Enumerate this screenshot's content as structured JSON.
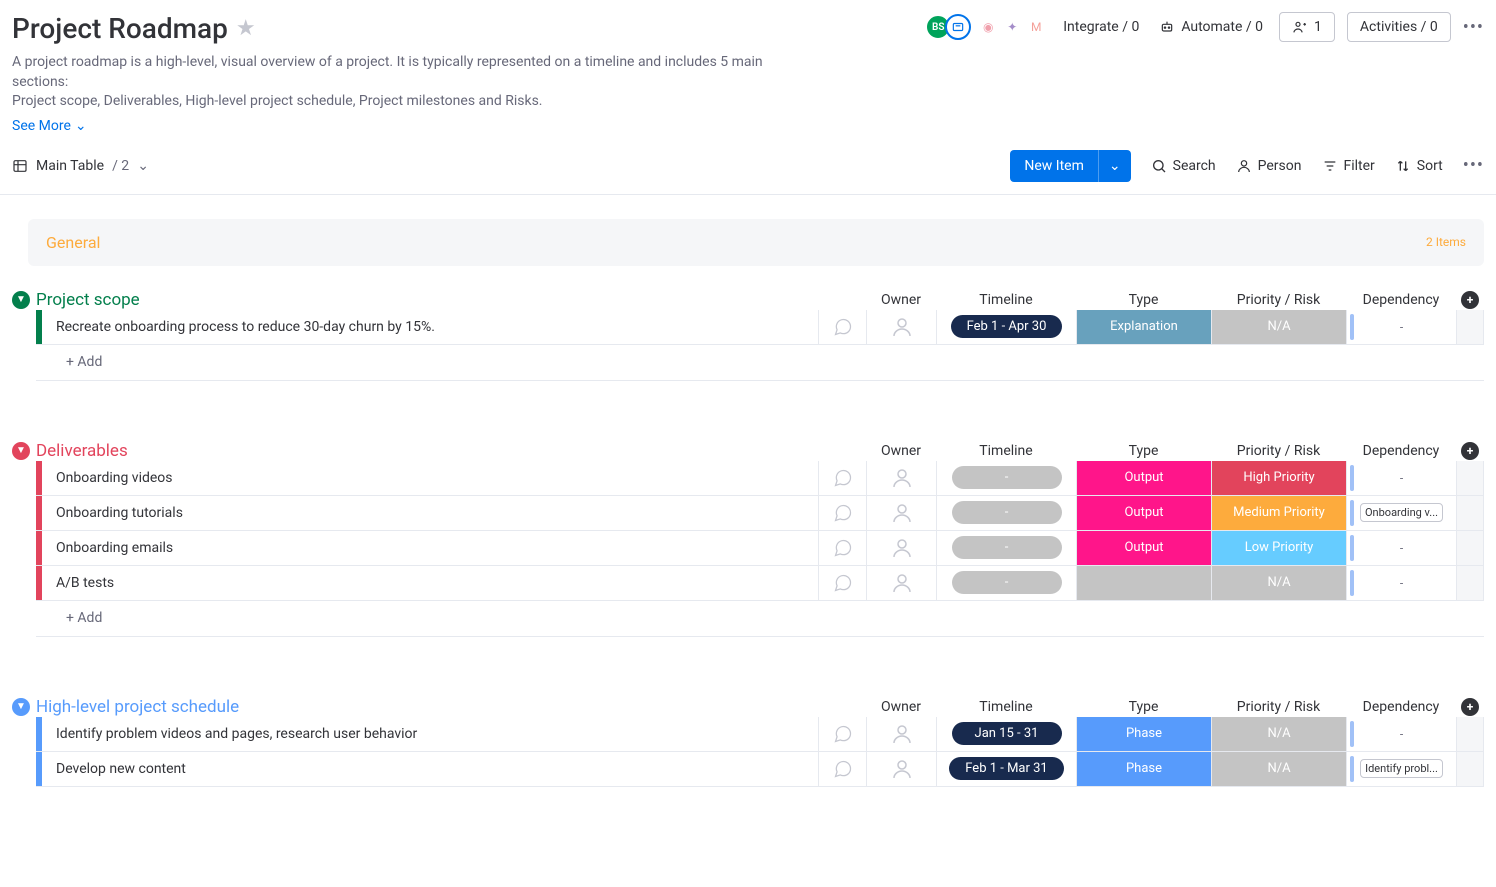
{
  "header": {
    "title": "Project Roadmap",
    "desc_line1": "A project roadmap is a high-level, visual overview of a project. It is typically represented on a timeline and includes 5 main sections:",
    "desc_line2": "Project scope, Deliverables, High-level project schedule, Project milestones and Risks.",
    "see_more": "See More",
    "integrate": "Integrate / 0",
    "automate": "Automate / 0",
    "invite": "1",
    "activities": "Activities / 0",
    "avatar_bs": "BS"
  },
  "toolbar": {
    "main_table": "Main Table",
    "view_count": "/ 2",
    "new_item": "New Item",
    "search": "Search",
    "person": "Person",
    "filter": "Filter",
    "sort": "Sort"
  },
  "general": {
    "name": "General",
    "count": "2 Items"
  },
  "columns": {
    "owner": "Owner",
    "timeline": "Timeline",
    "type": "Type",
    "priority": "Priority / Risk",
    "dependency": "Dependency"
  },
  "add_label": "+ Add",
  "groups": [
    {
      "id": "scope",
      "title": "Project scope",
      "color": "#037f4c",
      "rows": [
        {
          "name": "Recreate onboarding process to reduce 30-day churn by 15%.",
          "timeline": "Feb 1 - Apr 30",
          "timeline_style": "dark",
          "type": "Explanation",
          "type_bg": "#68a1bd",
          "priority": "N/A",
          "priority_bg": "#c4c4c4",
          "dep": "-"
        }
      ],
      "add": true
    },
    {
      "id": "deliv",
      "title": "Deliverables",
      "color": "#e2445c",
      "rows": [
        {
          "name": "Onboarding videos",
          "timeline": "-",
          "timeline_style": "grey",
          "type": "Output",
          "type_bg": "#ff158a",
          "priority": "High Priority",
          "priority_bg": "#e2445c",
          "dep": "-"
        },
        {
          "name": "Onboarding tutorials",
          "timeline": "-",
          "timeline_style": "grey",
          "type": "Output",
          "type_bg": "#ff158a",
          "priority": "Medium Priority",
          "priority_bg": "#fdab3d",
          "dep": "Onboarding v...",
          "dep_tag": true
        },
        {
          "name": "Onboarding emails",
          "timeline": "-",
          "timeline_style": "grey",
          "type": "Output",
          "type_bg": "#ff158a",
          "priority": "Low Priority",
          "priority_bg": "#66ccff",
          "dep": "-"
        },
        {
          "name": "A/B tests",
          "timeline": "-",
          "timeline_style": "grey",
          "type": "",
          "type_bg": "#c4c4c4",
          "priority": "N/A",
          "priority_bg": "#c4c4c4",
          "dep": "-"
        }
      ],
      "add": true
    },
    {
      "id": "schedule",
      "title": "High-level project schedule",
      "color": "#579bfc",
      "rows": [
        {
          "name": "Identify problem videos and pages, research user behavior",
          "timeline": "Jan 15 - 31",
          "timeline_style": "dark",
          "type": "Phase",
          "type_bg": "#579bfc",
          "priority": "N/A",
          "priority_bg": "#c4c4c4",
          "dep": "-"
        },
        {
          "name": "Develop new content",
          "timeline": "Feb 1 - Mar 31",
          "timeline_style": "dark",
          "type": "Phase",
          "type_bg": "#579bfc",
          "priority": "N/A",
          "priority_bg": "#c4c4c4",
          "dep": "Identify probl...",
          "dep_tag": true
        }
      ],
      "add": false
    }
  ]
}
